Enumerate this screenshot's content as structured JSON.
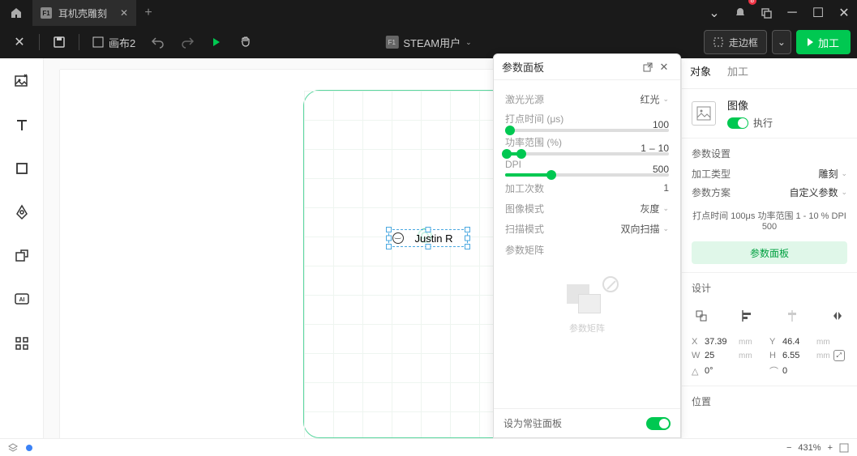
{
  "titlebar": {
    "tab_icon": "F1",
    "tab_title": "耳机壳雕刻",
    "notification_count": "8"
  },
  "toolbar": {
    "canvas_name": "画布2",
    "user_label": "STEAM用户",
    "frame_btn": "走边框",
    "process_btn": "加工"
  },
  "canvas": {
    "selected_text": "Justin R"
  },
  "params_panel": {
    "title": "参数面板",
    "laser_source_label": "激光光源",
    "laser_source_value": "红光",
    "dot_time_label": "打点时间 (μs)",
    "dot_time_value": "100",
    "power_label": "功率范围 (%)",
    "power_min": "1",
    "power_sep": "–",
    "power_max": "10",
    "dpi_label": "DPI",
    "dpi_value": "500",
    "passes_label": "加工次数",
    "passes_value": "1",
    "image_mode_label": "图像模式",
    "image_mode_value": "灰度",
    "scan_mode_label": "扫描模式",
    "scan_mode_value": "双向扫描",
    "matrix_label": "参数矩阵",
    "matrix_placeholder": "参数矩阵",
    "pin_label": "设为常驻面板"
  },
  "right_panel": {
    "tab_object": "对象",
    "tab_process": "加工",
    "image_title": "图像",
    "execute_label": "执行",
    "settings_heading": "参数设置",
    "process_type_label": "加工类型",
    "process_type_value": "雕刻",
    "scheme_label": "参数方案",
    "scheme_value": "自定义参数",
    "summary": "打点时间 100μs 功率范围  1 - 10 % DPI 500",
    "panel_btn": "参数面板",
    "design_heading": "设计",
    "x_label": "X",
    "x_value": "37.39",
    "unit_mm": "mm",
    "y_label": "Y",
    "y_value": "46.4",
    "w_label": "W",
    "w_value": "25",
    "h_label": "H",
    "h_value": "6.55",
    "angle_label": "△",
    "angle_value": "0°",
    "radius_label": "⌒",
    "radius_value": "0",
    "position_heading": "位置"
  },
  "statusbar": {
    "zoom": "431%"
  }
}
